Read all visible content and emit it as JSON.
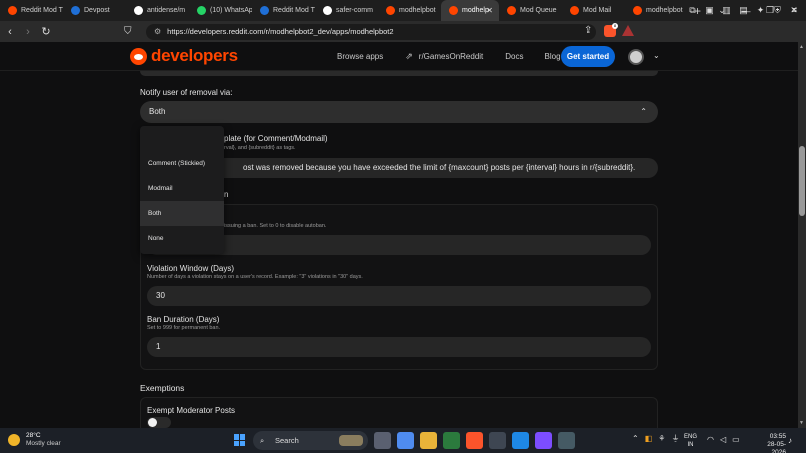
{
  "browser": {
    "tabs": [
      {
        "label": "Reddit Mod T",
        "icon": "reddit-icon",
        "color": "#ff4500"
      },
      {
        "label": "Devpost",
        "icon": "devpost-icon",
        "color": "#1f6fd6"
      },
      {
        "label": "antidense/m",
        "icon": "github-icon",
        "color": "#ffffff"
      },
      {
        "label": "(10) WhatsAp",
        "icon": "whatsapp-icon",
        "color": "#25d366"
      },
      {
        "label": "Reddit Mod T",
        "icon": "devpost-icon",
        "color": "#1f6fd6"
      },
      {
        "label": "safer-comm",
        "icon": "github-icon",
        "color": "#ffffff"
      },
      {
        "label": "modhelpbot",
        "icon": "reddit-icon",
        "color": "#ff4500"
      },
      {
        "label": "modhelp",
        "icon": "reddit-icon",
        "color": "#ff4500",
        "active": true
      },
      {
        "label": "Mod Queue",
        "icon": "reddit-icon",
        "color": "#ff4500"
      },
      {
        "label": "Mod Mail",
        "icon": "reddit-icon",
        "color": "#ff4500"
      },
      {
        "label": "modhelpbot",
        "icon": "reddit-icon",
        "color": "#ff4500"
      }
    ],
    "new_tab": "+",
    "url": "https://developers.reddit.com/r/modhelpbot2_dev/apps/modhelpbot2",
    "brave_badge": "8"
  },
  "header": {
    "logo": "developers",
    "nav": {
      "browse_apps": "Browse apps",
      "community": "r/GamesOnReddit",
      "docs": "Docs",
      "blog": "Blog"
    },
    "cta": "Get started",
    "accent": "#0a66d6"
  },
  "form": {
    "notify_label": "Notify user of removal via:",
    "notify_value": "Both",
    "template_label": "plate (for Comment/Modmail)",
    "template_hint": "rval}, and {subreddit} as tags.",
    "template_value": "ost was removed because you have exceeded the limit of {maxcount} posts per {interval} hours in r/{subreddit}.",
    "autoban_label": "n",
    "autoban_hint": "issuing a ban. Set to 0 to disable autoban.",
    "window_label": "Violation Window (Days)",
    "window_hint": "Number of days a violation stays on a user's record. Example: \"3\" violations in \"30\" days.",
    "window_value": "30",
    "ban_label": "Ban Duration (Days)",
    "ban_hint": "Set to 999 for permanent ban.",
    "ban_value": "1",
    "exemptions_heading": "Exemptions",
    "exempt_mod_label": "Exempt Moderator Posts"
  },
  "dropdown": {
    "options": [
      "Comment (Stickied)",
      "Modmail",
      "Both",
      "None"
    ],
    "selected": "Both"
  },
  "taskbar": {
    "temp": "28°C",
    "weather": "Mostly clear",
    "search": "Search",
    "lang1": "ENG",
    "lang2": "IN",
    "time": "03:55",
    "date": "28-05-2026"
  }
}
